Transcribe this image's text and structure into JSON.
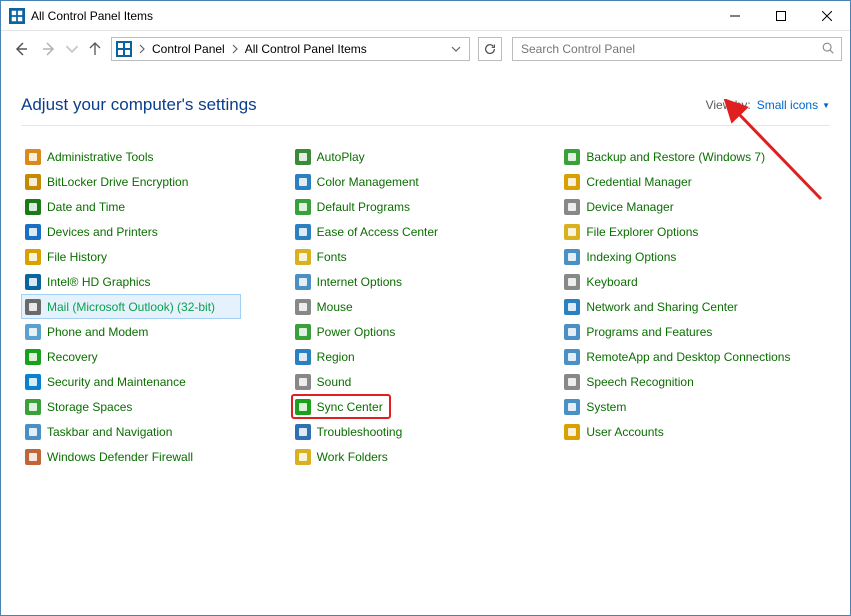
{
  "window": {
    "title": "All Control Panel Items"
  },
  "nav": {
    "breadcrumbs": [
      "Control Panel",
      "All Control Panel Items"
    ]
  },
  "search": {
    "placeholder": "Search Control Panel"
  },
  "header": {
    "title": "Adjust your computer's settings",
    "view_by_label": "View by:",
    "view_by_value": "Small icons"
  },
  "items": {
    "col1": [
      {
        "label": "Administrative Tools",
        "color": "#d88a1a"
      },
      {
        "label": "BitLocker Drive Encryption",
        "color": "#c48a00"
      },
      {
        "label": "Date and Time",
        "color": "#1a7a1a"
      },
      {
        "label": "Devices and Printers",
        "color": "#1a6fc4"
      },
      {
        "label": "File History",
        "color": "#d8a000"
      },
      {
        "label": "Intel® HD Graphics",
        "color": "#0a64a0"
      },
      {
        "label": "Mail (Microsoft Outlook) (32-bit)",
        "color": "#6a6a6a",
        "hover": true
      },
      {
        "label": "Phone and Modem",
        "color": "#5aa0d0"
      },
      {
        "label": "Recovery",
        "color": "#1aa01a"
      },
      {
        "label": "Security and Maintenance",
        "color": "#0a80d0"
      },
      {
        "label": "Storage Spaces",
        "color": "#3aa03a"
      },
      {
        "label": "Taskbar and Navigation",
        "color": "#4a90c4"
      },
      {
        "label": "Windows Defender Firewall",
        "color": "#c06535"
      }
    ],
    "col2": [
      {
        "label": "AutoPlay",
        "color": "#3a8a3a"
      },
      {
        "label": "Color Management",
        "color": "#2a80c0"
      },
      {
        "label": "Default Programs",
        "color": "#3aa03a"
      },
      {
        "label": "Ease of Access Center",
        "color": "#2a80c0"
      },
      {
        "label": "Fonts",
        "color": "#d8b020"
      },
      {
        "label": "Internet Options",
        "color": "#4a90c4"
      },
      {
        "label": "Mouse",
        "color": "#888"
      },
      {
        "label": "Power Options",
        "color": "#3aa03a"
      },
      {
        "label": "Region",
        "color": "#2a80c0"
      },
      {
        "label": "Sound",
        "color": "#888"
      },
      {
        "label": "Sync Center",
        "color": "#1aa01a",
        "highlight": true
      },
      {
        "label": "Troubleshooting",
        "color": "#3070b0"
      },
      {
        "label": "Work Folders",
        "color": "#d8b020"
      }
    ],
    "col3": [
      {
        "label": "Backup and Restore (Windows 7)",
        "color": "#3aa03a"
      },
      {
        "label": "Credential Manager",
        "color": "#d8a000"
      },
      {
        "label": "Device Manager",
        "color": "#888"
      },
      {
        "label": "File Explorer Options",
        "color": "#d8b020"
      },
      {
        "label": "Indexing Options",
        "color": "#4a90c4"
      },
      {
        "label": "Keyboard",
        "color": "#888"
      },
      {
        "label": "Network and Sharing Center",
        "color": "#2a80c0"
      },
      {
        "label": "Programs and Features",
        "color": "#4a90c4"
      },
      {
        "label": "RemoteApp and Desktop Connections",
        "color": "#4a90c4"
      },
      {
        "label": "Speech Recognition",
        "color": "#888"
      },
      {
        "label": "System",
        "color": "#4a90c4"
      },
      {
        "label": "User Accounts",
        "color": "#d8a000"
      }
    ]
  }
}
